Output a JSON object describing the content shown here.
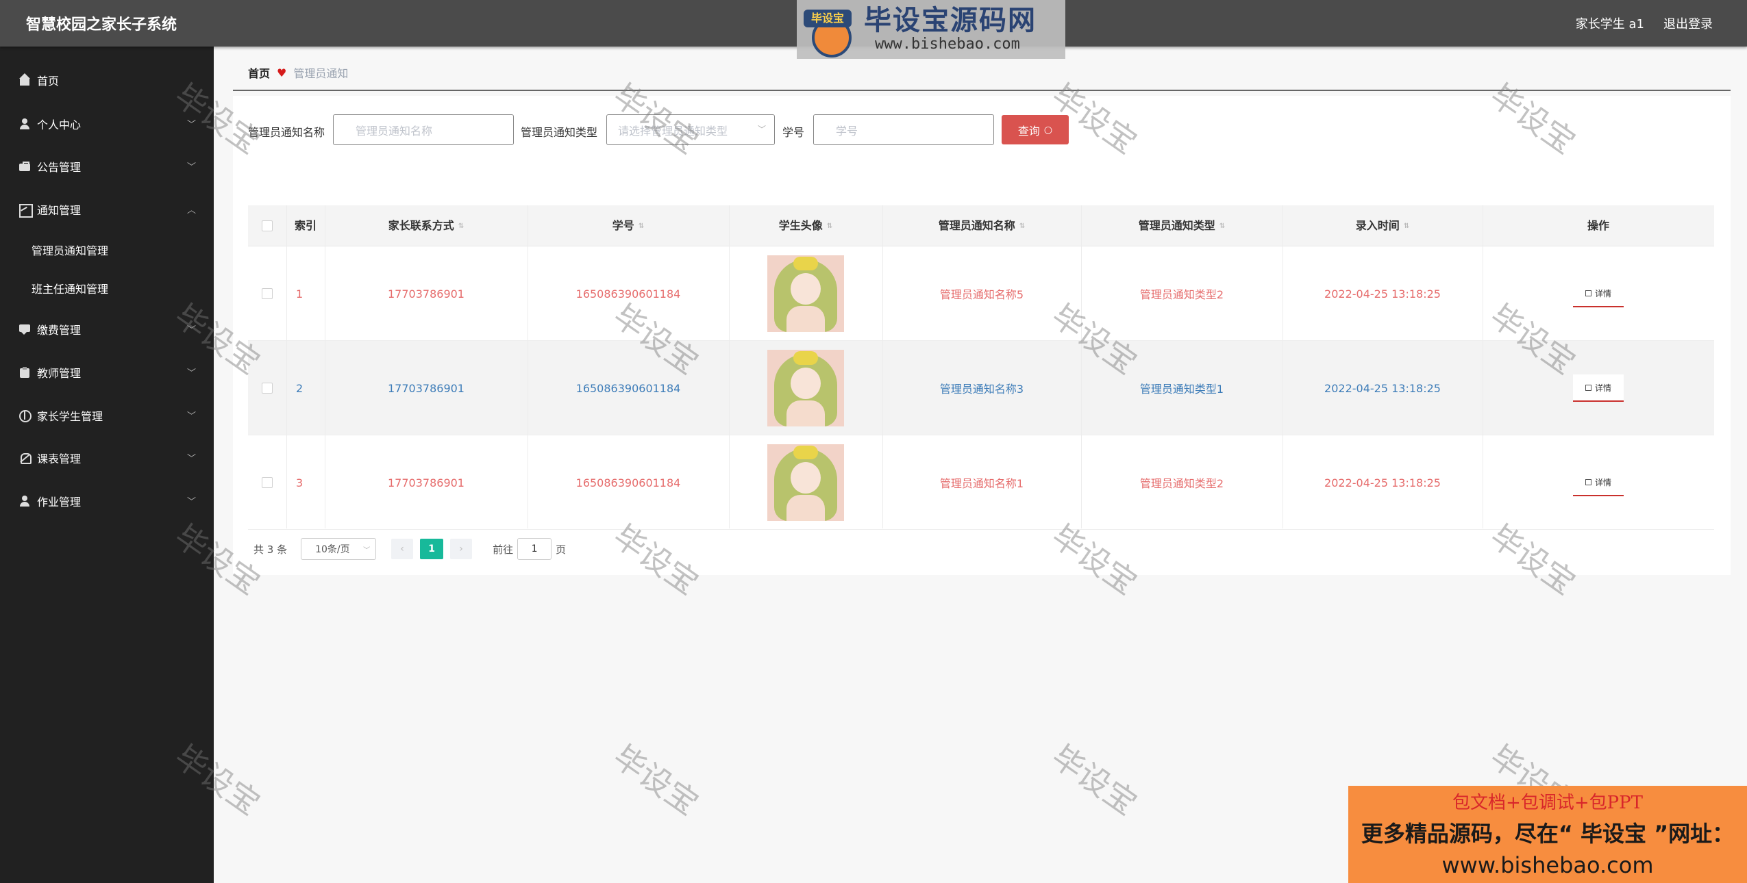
{
  "app": {
    "title": "智慧校园之家长子系统"
  },
  "header": {
    "user_label": "家长学生 a1",
    "logout_label": "退出登录"
  },
  "logo": {
    "tag": "毕设宝",
    "title": "毕设宝源码网",
    "url": "www.bishebao.com"
  },
  "sidebar": {
    "items": [
      {
        "label": "首页",
        "icon": "home-icon"
      },
      {
        "label": "个人中心",
        "icon": "user-icon"
      },
      {
        "label": "公告管理",
        "icon": "briefcase-icon"
      },
      {
        "label": "通知管理",
        "icon": "chart-icon"
      },
      {
        "label": "缴费管理",
        "icon": "message-icon"
      },
      {
        "label": "教师管理",
        "icon": "clipboard-icon"
      },
      {
        "label": "家长学生管理",
        "icon": "circle-icon"
      },
      {
        "label": "课表管理",
        "icon": "bell-icon"
      },
      {
        "label": "作业管理",
        "icon": "user-icon"
      }
    ],
    "subitems": [
      {
        "label": "管理员通知管理"
      },
      {
        "label": "班主任通知管理"
      }
    ]
  },
  "breadcrumb": {
    "home": "首页",
    "current": "管理员通知"
  },
  "search": {
    "name_label": "管理员通知名称",
    "name_placeholder": "管理员通知名称",
    "type_label": "管理员通知类型",
    "type_placeholder": "请选择管理员通知类型",
    "xuehao_label": "学号",
    "xuehao_placeholder": "学号",
    "query_label": "查询"
  },
  "table": {
    "headers": [
      "索引",
      "家长联系方式",
      "学号",
      "学生头像",
      "管理员通知名称",
      "管理员通知类型",
      "录入时间",
      "操作"
    ],
    "rows": [
      {
        "index": "1",
        "phone": "17703786901",
        "xuehao": "165086390601184",
        "name": "管理员通知名称5",
        "type": "管理员通知类型2",
        "time": "2022-04-25 13:18:25",
        "action": "详情"
      },
      {
        "index": "2",
        "phone": "17703786901",
        "xuehao": "165086390601184",
        "name": "管理员通知名称3",
        "type": "管理员通知类型1",
        "time": "2022-04-25 13:18:25",
        "action": "详情"
      },
      {
        "index": "3",
        "phone": "17703786901",
        "xuehao": "165086390601184",
        "name": "管理员通知名称1",
        "type": "管理员通知类型2",
        "time": "2022-04-25 13:18:25",
        "action": "详情"
      }
    ]
  },
  "pagination": {
    "total": "共 3 条",
    "page_size": "10条/页",
    "current": "1",
    "goto_label": "前往",
    "goto_value": "1",
    "page_unit": "页"
  },
  "watermark": "毕设宝",
  "ad": {
    "line1": "包文档+包调试+包PPT",
    "line2": "更多精品源码，尽在“ 毕设宝 ”网址：",
    "line3": "www.bishebao.com"
  },
  "colors": {
    "sidebar": "#212121",
    "topbar": "#4b4b4b",
    "accent": "#d9534f",
    "row_red": "#e66c6c",
    "row_blue": "#3d7cb8",
    "pager": "#17b99a"
  }
}
